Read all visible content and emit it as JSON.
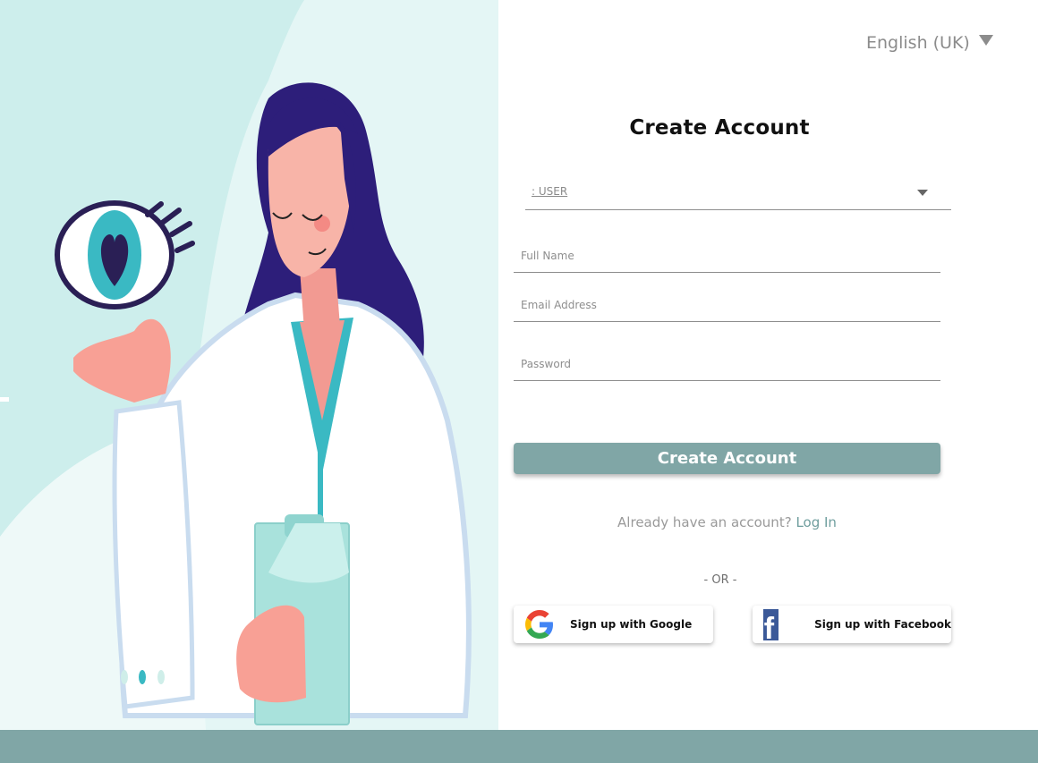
{
  "language": {
    "label": "English (UK)"
  },
  "form": {
    "title": "Create Account",
    "role_value": ": USER",
    "full_name_placeholder": "Full Name",
    "email_placeholder": "Email Address",
    "password_placeholder": "Password",
    "submit_label": "Create Account",
    "already_text": "Already have an account?",
    "login_link": "Log In",
    "or_text": "- OR -"
  },
  "social": {
    "google_label": "Sign up with Google",
    "facebook_label": "Sign up with Facebook"
  },
  "icons": {
    "language_caret": "triangle-down-icon",
    "role_caret": "chevron-down-icon",
    "google": "google-logo-icon",
    "facebook": "facebook-logo-icon"
  },
  "colors": {
    "accent": "#80a6a6",
    "panel_bg": "#cdeeec",
    "link": "#6f9e9e"
  }
}
